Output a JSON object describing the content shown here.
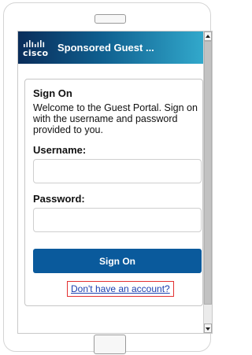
{
  "header": {
    "logo_text": "cisco",
    "title": "Sponsored Guest ..."
  },
  "card": {
    "title": "Sign On",
    "welcome_text": "Welcome to the Guest Portal. Sign on with the username and password provided to you.",
    "username_label": "Username:",
    "username_value": "",
    "password_label": "Password:",
    "password_value": "",
    "signon_button": "Sign On",
    "account_link": "Don't have an account?"
  },
  "colors": {
    "header_start": "#0a2d5a",
    "header_end": "#32a9cc",
    "button": "#0a5a9c",
    "link": "#1a3fb0",
    "highlight": "#e23131"
  },
  "icons": {
    "logo": "cisco-logo-icon",
    "scroll_up": "scroll-up-arrow-icon",
    "scroll_down": "scroll-down-arrow-icon"
  }
}
